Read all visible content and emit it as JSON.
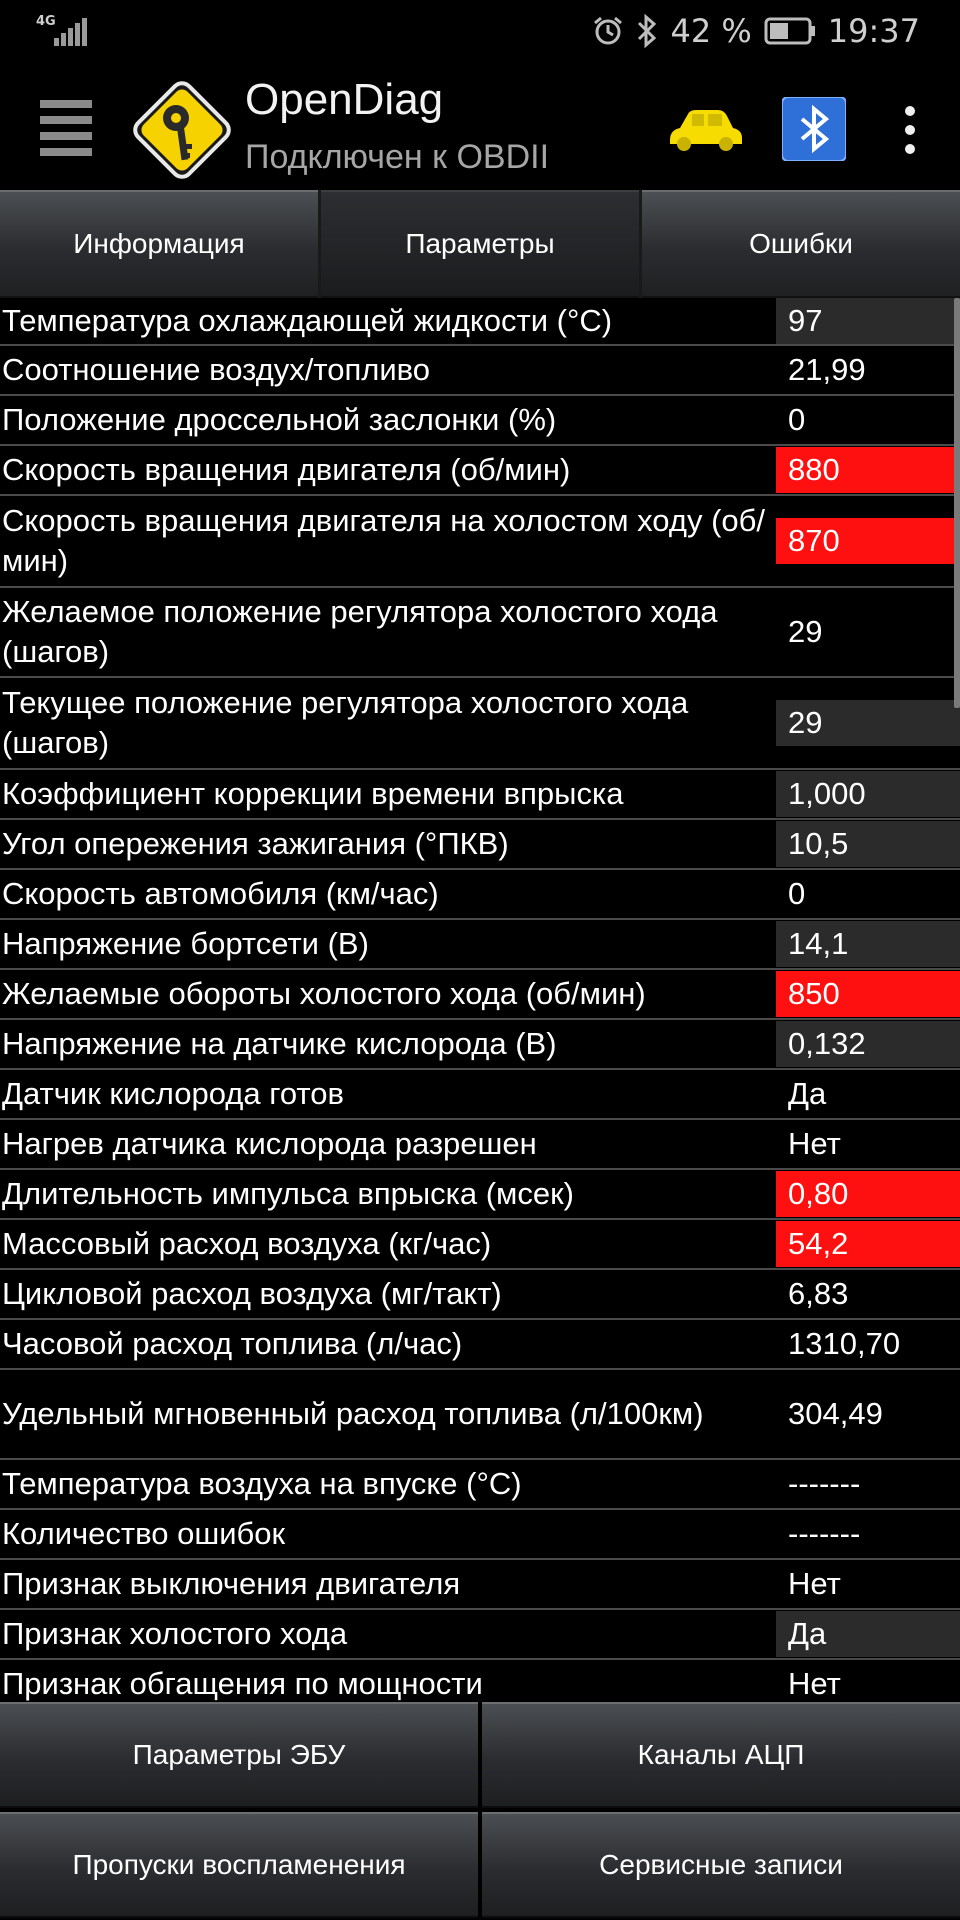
{
  "status_bar": {
    "network": "4G",
    "battery_percent": "42 %",
    "time": "19:37"
  },
  "app_bar": {
    "title": "OpenDiag",
    "subtitle": "Подключен к OBDII"
  },
  "tabs": [
    {
      "label": "Информация",
      "active": false
    },
    {
      "label": "Параметры",
      "active": true
    },
    {
      "label": "Ошибки",
      "active": false
    }
  ],
  "parameters": [
    {
      "name": "Температура охлаждающей жидкости (°C)",
      "value": "97",
      "highlight": "gray"
    },
    {
      "name": "Соотношение воздух/топливо",
      "value": "21,99",
      "highlight": "none"
    },
    {
      "name": "Положение дроссельной заслонки (%)",
      "value": "0",
      "highlight": "none"
    },
    {
      "name": "Скорость вращения двигателя (об/мин)",
      "value": "880",
      "highlight": "red"
    },
    {
      "name": "Скорость вращения двигателя на холостом ходу (об/мин)",
      "value": "870",
      "highlight": "red"
    },
    {
      "name": "Желаемое положение регулятора холостого хода (шагов)",
      "value": "29",
      "highlight": "none"
    },
    {
      "name": "Текущее положение регулятора холостого хода (шагов)",
      "value": "29",
      "highlight": "gray"
    },
    {
      "name": "Коэффициент коррекции времени впрыска",
      "value": "1,000",
      "highlight": "gray"
    },
    {
      "name": "Угол опережения зажигания (°ПКВ)",
      "value": "10,5",
      "highlight": "gray"
    },
    {
      "name": "Скорость автомобиля (км/час)",
      "value": "0",
      "highlight": "none"
    },
    {
      "name": "Напряжение бортсети (В)",
      "value": "14,1",
      "highlight": "gray"
    },
    {
      "name": "Желаемые обороты холостого хода (об/мин)",
      "value": "850",
      "highlight": "red"
    },
    {
      "name": "Напряжение на датчике кислорода (В)",
      "value": "0,132",
      "highlight": "gray"
    },
    {
      "name": "Датчик кислорода готов",
      "value": "Да",
      "highlight": "none"
    },
    {
      "name": "Нагрев датчика кислорода разрешен",
      "value": "Нет",
      "highlight": "none"
    },
    {
      "name": "Длительность импульса впрыска (мсек)",
      "value": "0,80",
      "highlight": "red"
    },
    {
      "name": "Массовый расход воздуха (кг/час)",
      "value": "54,2",
      "highlight": "red"
    },
    {
      "name": "Цикловой расход воздуха (мг/такт)",
      "value": "6,83",
      "highlight": "none"
    },
    {
      "name": "Часовой расход топлива (л/час)",
      "value": "1310,70",
      "highlight": "none"
    },
    {
      "name": "Удельный мгновенный расход топлива (л/100км)",
      "value": "304,49",
      "highlight": "none"
    },
    {
      "name": "Температура воздуха на впуске (°C)",
      "value": "-------",
      "highlight": "none"
    },
    {
      "name": "Количество ошибок",
      "value": "-------",
      "highlight": "none"
    },
    {
      "name": "Признак выключения двигателя",
      "value": "Нет",
      "highlight": "none"
    },
    {
      "name": "Признак холостого хода",
      "value": "Да",
      "highlight": "gray"
    },
    {
      "name": "Признак обгащения по мощности",
      "value": "Нет",
      "highlight": "none"
    }
  ],
  "bottom_buttons": [
    {
      "label": "Параметры ЭБУ"
    },
    {
      "label": "Каналы АЦП"
    },
    {
      "label": "Пропуски воспламенения"
    },
    {
      "label": "Сервисные записи"
    }
  ],
  "colors": {
    "alert_red": "#ff1010",
    "value_gray": "#2b2b2b",
    "logo_yellow": "#f6d200",
    "car_yellow": "#f6dc00",
    "bluetooth_blue": "#2e6fd8"
  }
}
